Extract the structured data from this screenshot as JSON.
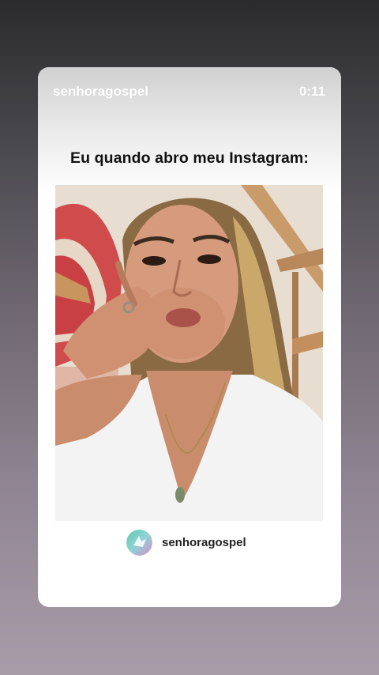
{
  "story": {
    "username": "senhoragospel",
    "timer": "0:11"
  },
  "post": {
    "caption": "Eu quando abro meu Instagram:",
    "account_name": "senhoragospel"
  },
  "colors": {
    "card_background": "#ffffff",
    "caption_text": "#111111",
    "header_text": "#ffffff"
  }
}
